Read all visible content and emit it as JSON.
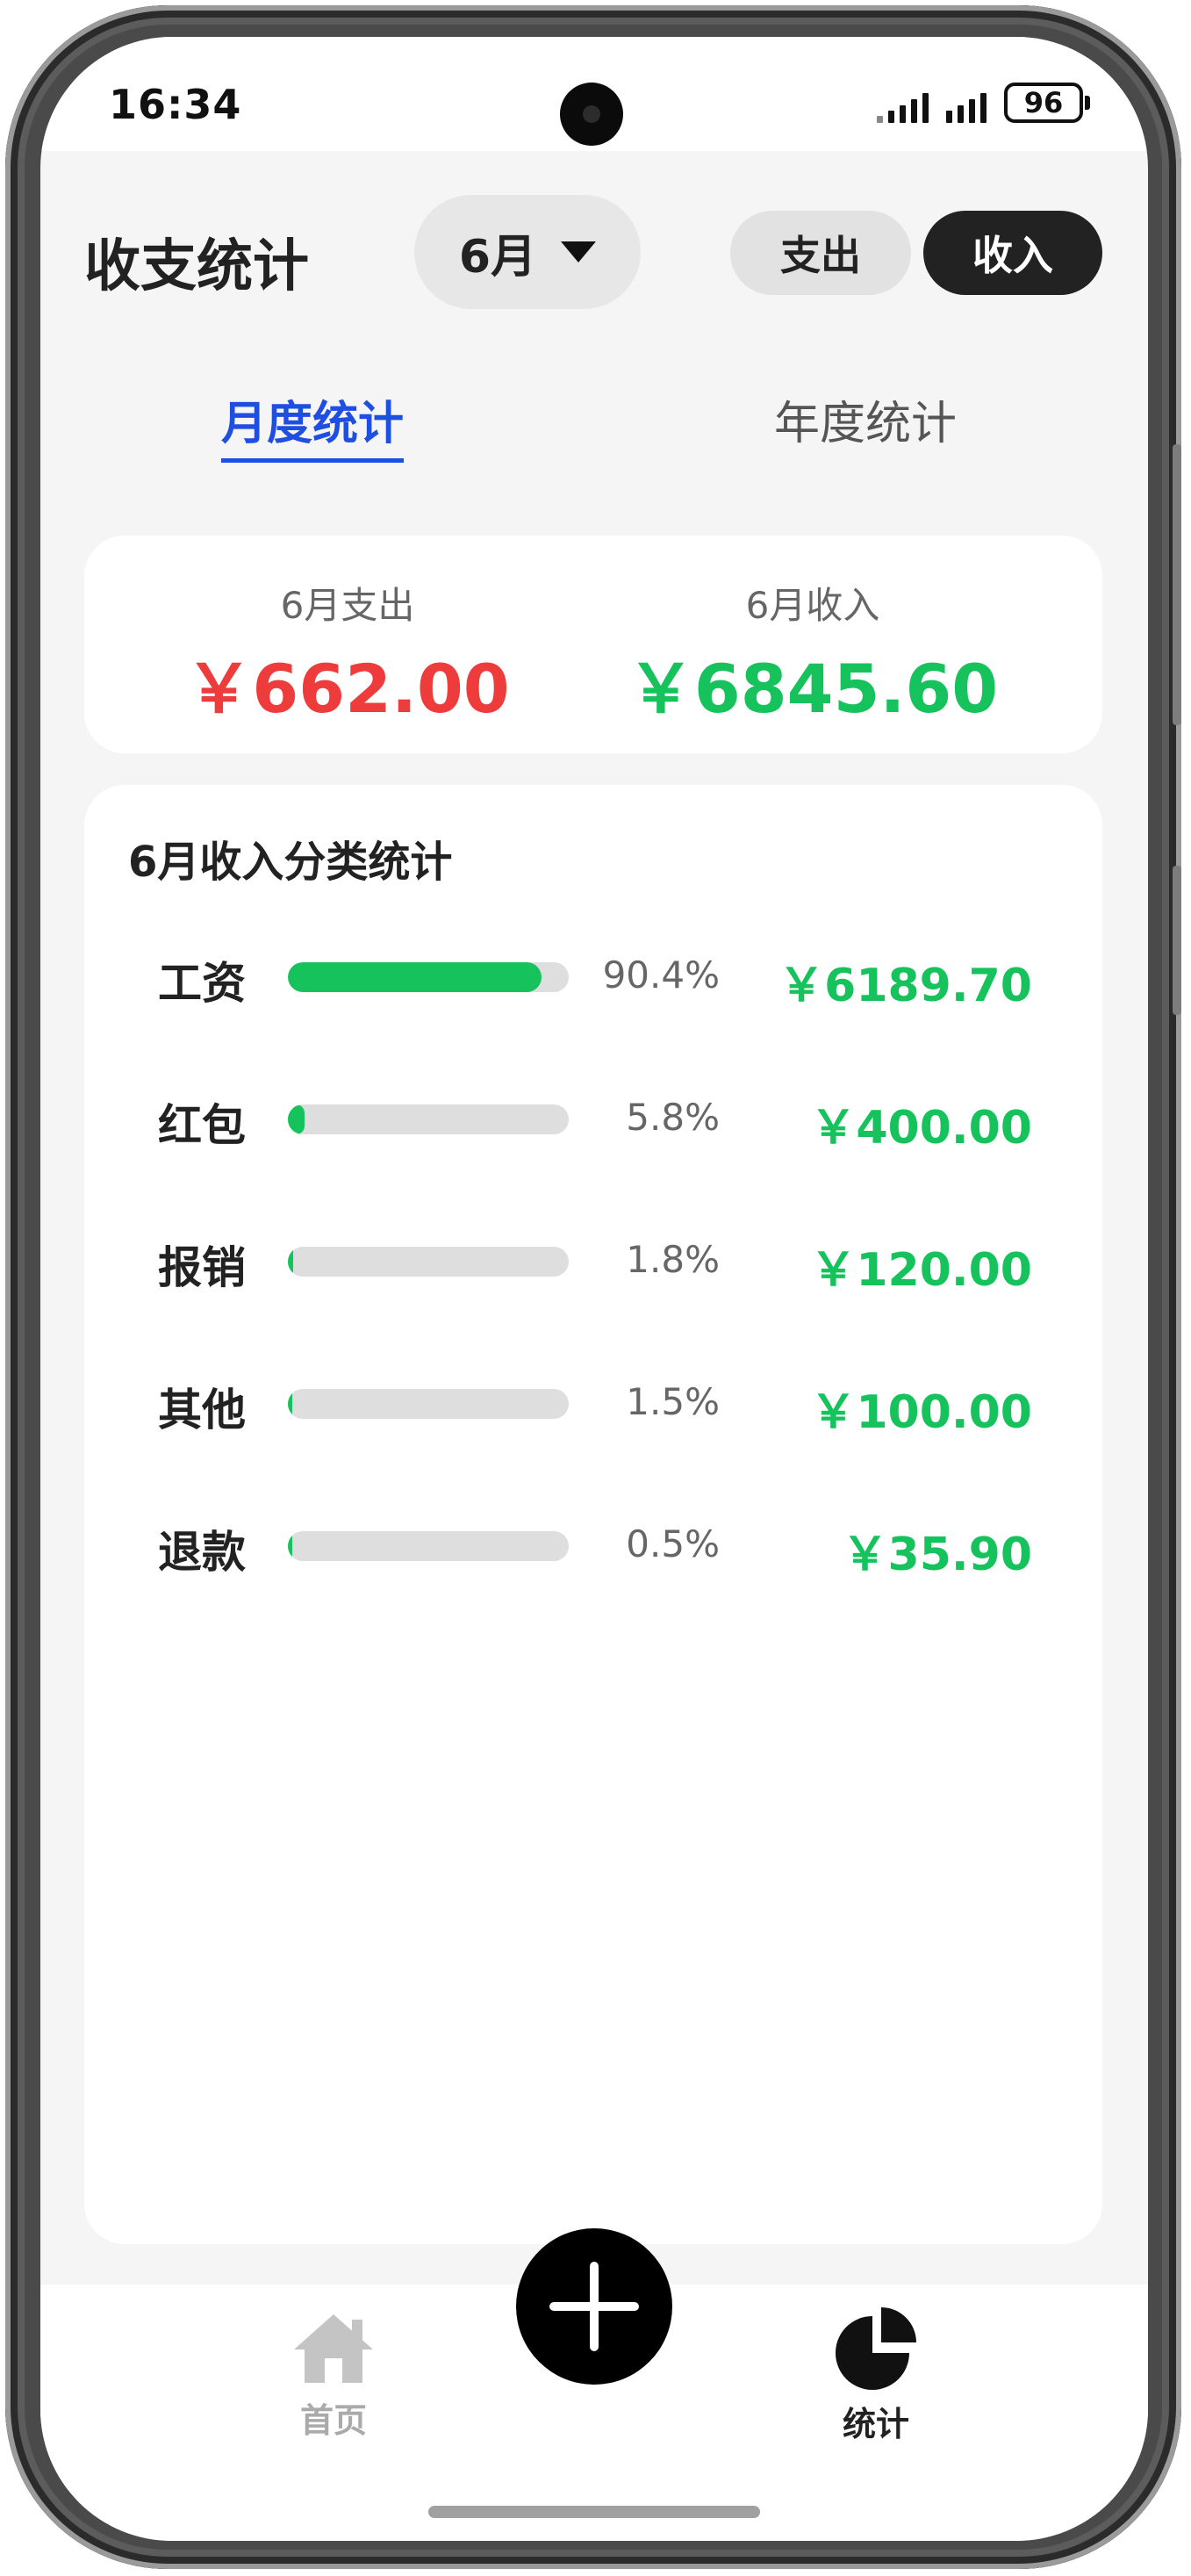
{
  "status_bar": {
    "time": "16:34",
    "battery": "96"
  },
  "header": {
    "title": "收支统计",
    "month": "6月",
    "toggle_expense": "支出",
    "toggle_income": "收入"
  },
  "tabs": {
    "monthly": "月度统计",
    "yearly": "年度统计"
  },
  "summary": {
    "expense_label": "6月支出",
    "expense_value": "￥662.00",
    "income_label": "6月收入",
    "income_value": "￥6845.60"
  },
  "detail": {
    "title": "6月收入分类统计",
    "items": [
      {
        "name": "工资",
        "percent_text": "90.4%",
        "ratio": 0.904,
        "amount": "￥6189.70"
      },
      {
        "name": "红包",
        "percent_text": "5.8%",
        "ratio": 0.058,
        "amount": "￥400.00"
      },
      {
        "name": "报销",
        "percent_text": "1.8%",
        "ratio": 0.018,
        "amount": "￥120.00"
      },
      {
        "name": "其他",
        "percent_text": "1.5%",
        "ratio": 0.015,
        "amount": "￥100.00"
      },
      {
        "name": "退款",
        "percent_text": "0.5%",
        "ratio": 0.005,
        "amount": "￥35.90"
      }
    ]
  },
  "bottom_nav": {
    "home_label": "首页",
    "stats_label": "统计",
    "home_icon": "home-icon",
    "stats_icon": "pie-chart-icon",
    "add_icon": "plus-icon"
  },
  "colors": {
    "accent_blue": "#1f4fe0",
    "expense_red": "#ee3b3b",
    "income_green": "#16c25b"
  }
}
